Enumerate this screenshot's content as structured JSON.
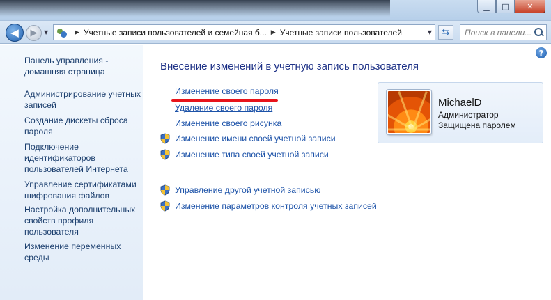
{
  "window": {
    "minimize_label": "▁",
    "maximize_label": "□",
    "close_label": "✕"
  },
  "navigation": {
    "breadcrumbs": [
      "Учетные записи пользователей и семейная б...",
      "Учетные записи пользователей"
    ],
    "search_placeholder": "Поиск в панели..."
  },
  "sidebar": {
    "items": [
      {
        "label": "Панель управления - домашняя страница"
      },
      {
        "label": "Администрирование учетных записей"
      },
      {
        "label": "Создание дискеты сброса пароля"
      },
      {
        "label": "Подключение идентификаторов пользователей Интернета"
      },
      {
        "label": "Управление сертификатами шифрования файлов"
      },
      {
        "label": "Настройка дополнительных свойств профиля пользователя"
      },
      {
        "label": "Изменение переменных среды"
      }
    ]
  },
  "main": {
    "title": "Внесение изменений в учетную запись пользователя",
    "tasks": [
      {
        "label": "Изменение своего пароля",
        "shield": false
      },
      {
        "label": "Удаление своего пароля",
        "shield": false
      },
      {
        "label": "Изменение своего рисунка",
        "shield": false
      },
      {
        "label": "Изменение имени своей учетной записи",
        "shield": true
      },
      {
        "label": "Изменение типа своей учетной записи",
        "shield": true
      }
    ],
    "other_tasks": [
      {
        "label": "Управление другой учетной записью",
        "shield": true
      },
      {
        "label": "Изменение параметров контроля учетных записей",
        "shield": true
      }
    ]
  },
  "user": {
    "name": "MichaelD",
    "role": "Администратор",
    "status": "Защищена паролем"
  },
  "icons": {
    "back": "arrow-left-icon",
    "forward": "arrow-right-icon",
    "refresh": "refresh-icon",
    "search": "search-icon",
    "help": "help-icon",
    "shield": "uac-shield-icon"
  }
}
